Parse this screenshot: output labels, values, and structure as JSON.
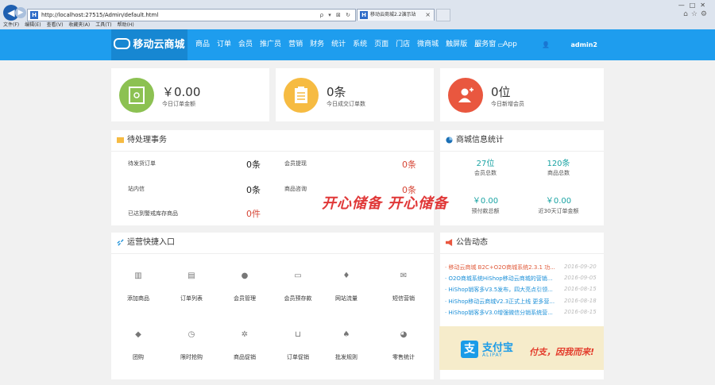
{
  "browser": {
    "url": "http://localhost:27515/Admin/default.html",
    "tab_title": "移动云商城2.2演示站",
    "menu": [
      "文件(F)",
      "编辑(E)",
      "查看(V)",
      "收藏夹(A)",
      "工具(T)",
      "帮助(H)"
    ],
    "address_tools": "ρ ▾ ⊠ ↻"
  },
  "header": {
    "logo": "移动云商城",
    "nav": [
      "商品",
      "订单",
      "会员",
      "推广员",
      "营销",
      "财务",
      "统计",
      "系统",
      "页面",
      "门店",
      "微商城",
      "触屏版",
      "服务窗",
      "App"
    ],
    "user": "admin2"
  },
  "stats": [
    {
      "value": "￥0.00",
      "label": "今日订单金额",
      "color": "#8cc152"
    },
    {
      "value": "0条",
      "label": "今日成交订单数",
      "color": "#f6bb42"
    },
    {
      "value": "0位",
      "label": "今日新增会员",
      "color": "#e9573f"
    }
  ],
  "pending": {
    "title": "待处理事务",
    "rows": [
      {
        "label": "待发货订单",
        "value": "0条",
        "label2": "会员提现",
        "value2": "0条"
      },
      {
        "label": "站内信",
        "value": "0条",
        "label2": "商品咨询",
        "value2": "0条"
      },
      {
        "label": "已达到警戒库存商品",
        "value": "0件"
      }
    ]
  },
  "mall_stats": {
    "title": "商城信息统计",
    "items": [
      {
        "value": "27位",
        "label": "会员总数"
      },
      {
        "value": "120条",
        "label": "商品总数"
      },
      {
        "value": "￥0.00",
        "label": "预付款总额"
      },
      {
        "value": "￥0.00",
        "label": "近30天订单金额"
      }
    ]
  },
  "watermark": "开心储备 开心储备",
  "quick": {
    "title": "运营快捷入口",
    "items": [
      {
        "label": "添加商品",
        "icon": "barcode-icon",
        "glyph": "▥"
      },
      {
        "label": "订单列表",
        "icon": "list-icon",
        "glyph": "▤"
      },
      {
        "label": "会员管理",
        "icon": "user-icon",
        "glyph": "●"
      },
      {
        "label": "会员预存款",
        "icon": "card-icon",
        "glyph": "▭"
      },
      {
        "label": "网站流量",
        "icon": "drop-icon",
        "glyph": "♦"
      },
      {
        "label": "短信营销",
        "icon": "envelope-icon",
        "glyph": "✉"
      },
      {
        "label": "团购",
        "icon": "tag-icon",
        "glyph": "◆"
      },
      {
        "label": "限时抢购",
        "icon": "clock-icon",
        "glyph": "◷"
      },
      {
        "label": "商品促销",
        "icon": "gear-icon",
        "glyph": "✲"
      },
      {
        "label": "订单促销",
        "icon": "basket-icon",
        "glyph": "⊔"
      },
      {
        "label": "批发规则",
        "icon": "fire-icon",
        "glyph": "♠"
      },
      {
        "label": "零售统计",
        "icon": "piechart-icon",
        "glyph": "◕"
      }
    ]
  },
  "announcements": {
    "title": "公告动态",
    "items": [
      {
        "text": "· 移动云商城 B2C+O2O商城系统2.3.1 功...",
        "date": "2016-09-20",
        "highlight": true
      },
      {
        "text": "· O2O商城系统HiShop移动云商城的营销...",
        "date": "2016-09-05",
        "highlight": false
      },
      {
        "text": "· HiShop销客多V3.5发布，四大亮点引领...",
        "date": "2016-08-15",
        "highlight": false
      },
      {
        "text": "· HiShop移动云商城V2.3正式上线 更多营...",
        "date": "2016-08-18",
        "highlight": false
      },
      {
        "text": "· HiShop销客多V3.0增强微信分销系统营...",
        "date": "2016-08-15",
        "highlight": false
      }
    ],
    "banner": {
      "brand": "支付宝",
      "brand_en": "ALIPAY",
      "slogan": "付支，因我而来!"
    }
  }
}
